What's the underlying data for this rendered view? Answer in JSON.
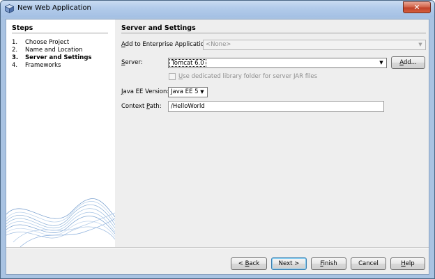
{
  "window": {
    "title": "New Web Application",
    "close_glyph": "✕"
  },
  "steps": {
    "heading": "Steps",
    "items": [
      {
        "num": "1.",
        "label": "Choose Project"
      },
      {
        "num": "2.",
        "label": "Name and Location"
      },
      {
        "num": "3.",
        "label": "Server and Settings"
      },
      {
        "num": "4.",
        "label": "Frameworks"
      }
    ]
  },
  "panel": {
    "heading": "Server and Settings",
    "enterprise": {
      "label_pre": "",
      "label_mn": "A",
      "label_post": "dd to Enterprise Application:",
      "value": "<None>"
    },
    "server": {
      "label_mn": "S",
      "label_post": "erver:",
      "value": "Tomcat 6.0",
      "add_mn": "A",
      "add_post": "dd..."
    },
    "dedicated": {
      "label_mn": "U",
      "label_post": "se dedicated library folder for server JAR files"
    },
    "javaee": {
      "label_mn": "J",
      "label_post": "ava EE Version:",
      "value": "Java EE 5"
    },
    "context": {
      "label_pre": "Context ",
      "label_mn": "P",
      "label_post": "ath:",
      "value": "/HelloWorld"
    }
  },
  "buttons": {
    "back": {
      "pre": "< ",
      "mn": "B",
      "post": "ack"
    },
    "next": {
      "pre": "Next >",
      "mn": "",
      "post": ""
    },
    "finish": {
      "pre": "",
      "mn": "F",
      "post": "inish"
    },
    "cancel": {
      "pre": "Cancel",
      "mn": "",
      "post": ""
    },
    "help": {
      "pre": "",
      "mn": "H",
      "post": "elp"
    }
  },
  "colors": {
    "titlebar": "#b2cbea",
    "close": "#c0422a",
    "default_button_border": "#3c7fb1"
  }
}
